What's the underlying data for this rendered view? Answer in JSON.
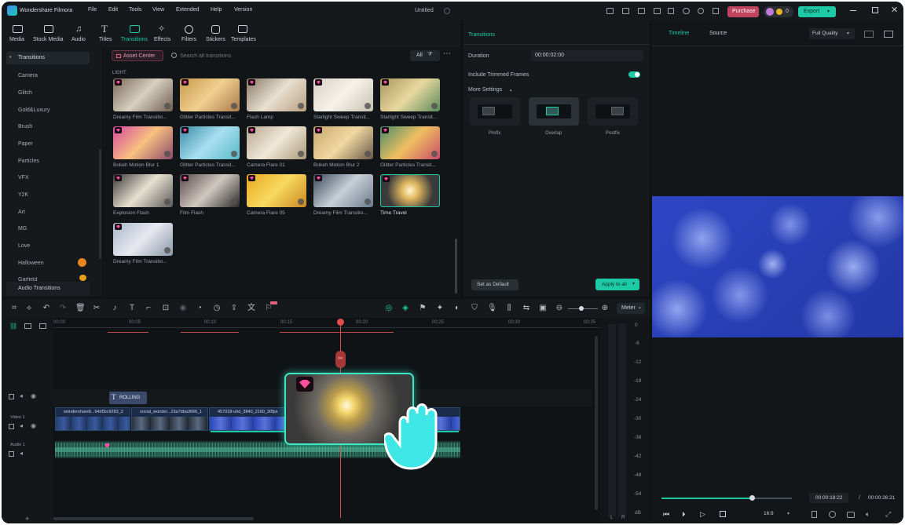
{
  "app": {
    "name": "Wondershare Filmora",
    "project": "Untitled"
  },
  "menu": [
    "File",
    "Edit",
    "Tools",
    "View",
    "Extended",
    "Help",
    "Version"
  ],
  "header": {
    "purchase": "Purchase",
    "points": "0",
    "export": "Export"
  },
  "toolbar_tabs": [
    "Media",
    "Stock Media",
    "Audio",
    "Titles",
    "Transitions",
    "Effects",
    "Filters",
    "Stickers",
    "Templates"
  ],
  "sidebar": {
    "heading": "Transitions",
    "items": [
      "Camera",
      "Glitch",
      "Gold&Luxury",
      "Brush",
      "Paper",
      "Particles",
      "VFX",
      "Y2K",
      "Art",
      "MG",
      "Love",
      "Halloween",
      "Garfield"
    ],
    "footer": "Audio Transitions"
  },
  "browser": {
    "asset_center": "Asset Center",
    "search_placeholder": "Search all transitions",
    "filter": "All",
    "section": "LIGHT",
    "items": [
      "Dreamy Film Transitio...",
      "Glitter Particles Transit...",
      "Flash Lamp",
      "Starlight Sweep Transit...",
      "Starlight Sweep Transit...",
      "Bokeh Motion Blur 1",
      "Glitter Particles Transit...",
      "Camera Flare 01",
      "Bokeh Motion Blur 2",
      "Glitter Particles Transit...",
      "Explosion Flash",
      "Film Flash",
      "Camera Flare 05",
      "Dreamy Film Transitio...",
      "Time Travel",
      "Dreamy Film Transitio..."
    ]
  },
  "props": {
    "title": "Transitions",
    "duration_label": "Duration",
    "duration_value": "00:00:02:00",
    "include_trimmed": "Include Trimmed Frames",
    "more_settings": "More Settings",
    "modes": [
      "Prefix",
      "Overlap",
      "Postfix"
    ],
    "set_default": "Set as Default",
    "apply_all": "Apply to all"
  },
  "preview": {
    "tabs": [
      "Timeline",
      "Source"
    ],
    "quality": "Full Quality",
    "current_time": "00:00:18:22",
    "separator": "/",
    "total_time": "00:00:26:21",
    "ratio": "16:9"
  },
  "timeline": {
    "meter_label": "Meter",
    "ruler": [
      "00:00",
      "00:05",
      "00:10",
      "00:15",
      "00:20",
      "00:25",
      "00:30",
      "00:35"
    ],
    "title_clip": "ROLLING",
    "video_track": "Video 1",
    "audio_track": "Audio 1",
    "clips": [
      "wondershare8...64d5bc9283_2",
      "social_wonder...23a7dba3666_1",
      "457018-uhd_3840_2160_30fps"
    ],
    "meter_scale": [
      "0",
      "-6",
      "-12",
      "-18",
      "-24",
      "-30",
      "-36",
      "-42",
      "-48",
      "-54",
      "dB"
    ],
    "meter_lr": [
      "L",
      "R"
    ]
  },
  "colors": {
    "accent": "#1ec9a5",
    "purchase": "#c0445e",
    "playhead": "#e04b4b",
    "bg": "#0f1214",
    "panel": "#16191c"
  }
}
